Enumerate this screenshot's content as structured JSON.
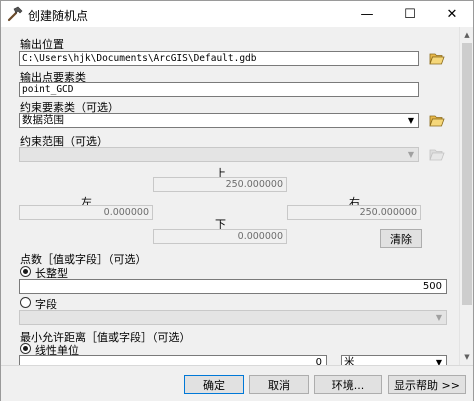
{
  "window": {
    "title": "创建随机点",
    "minimize_glyph": "—",
    "maximize_glyph": "☐",
    "close_glyph": "✕"
  },
  "output_location": {
    "label": "输出位置",
    "value": "C:\\Users\\hjk\\Documents\\ArcGIS\\Default.gdb"
  },
  "output_feature_class": {
    "label": "输出点要素类",
    "value": "point_GCD"
  },
  "constraint_feature_class": {
    "label": "约束要素类（可选）",
    "value": "数据范围"
  },
  "constraint_extent": {
    "label": "约束范围（可选）",
    "top_label": "上",
    "top_value": "250.000000",
    "left_label": "左",
    "left_value": "0.000000",
    "right_label": "右",
    "right_value": "250.000000",
    "bottom_label": "下",
    "bottom_value": "0.000000",
    "clear_label": "清除"
  },
  "point_count": {
    "label": "点数［值或字段］（可选）",
    "long_option": "长整型",
    "long_value": "500",
    "field_option": "字段"
  },
  "min_distance": {
    "label": "最小允许距离［值或字段］（可选）",
    "linear_option": "线性单位",
    "value": "0",
    "unit": "米"
  },
  "footer": {
    "ok": "确定",
    "cancel": "取消",
    "environments": "环境...",
    "show_help": "显示帮助 >>"
  }
}
